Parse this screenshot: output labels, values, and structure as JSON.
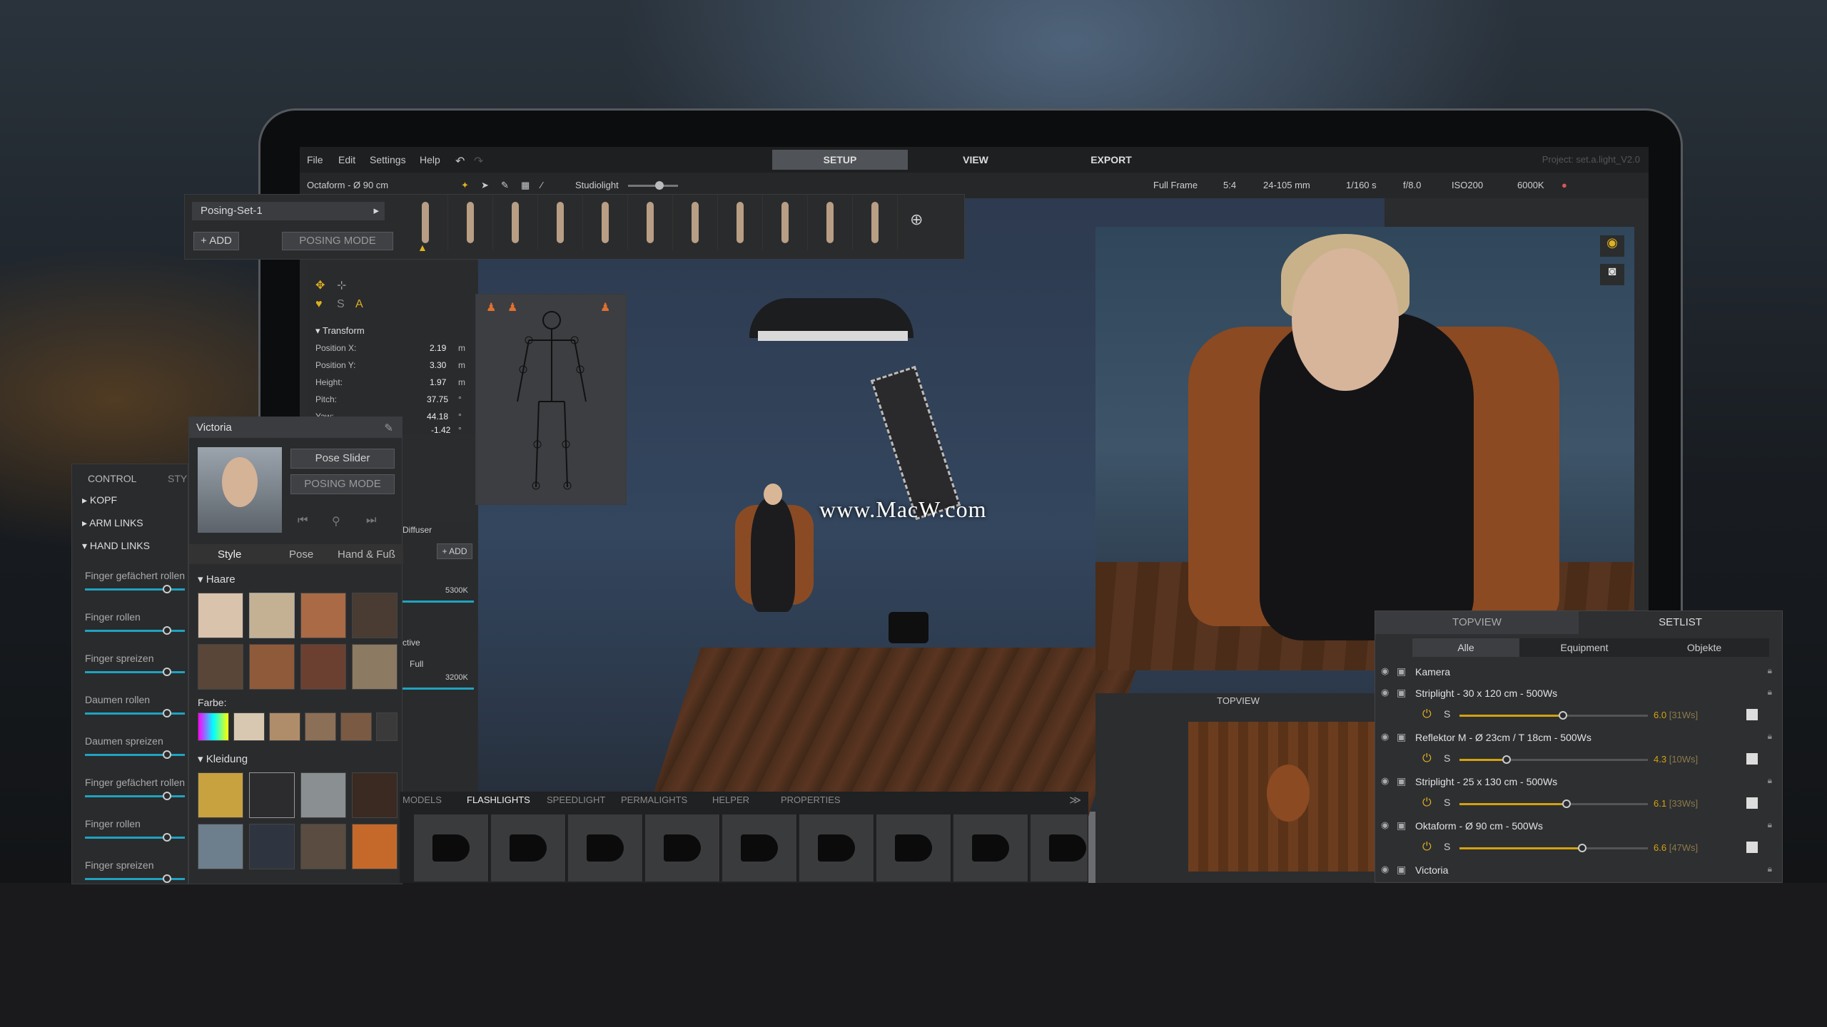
{
  "menu": {
    "file": "File",
    "edit": "Edit",
    "settings": "Settings",
    "help": "Help",
    "tabs": [
      "SETUP",
      "VIEW",
      "EXPORT"
    ],
    "project": "Project: set.a.light_V2.0"
  },
  "toolbar": {
    "object": "Octaform - Ø 90 cm",
    "studiolight": "Studiolight"
  },
  "camera": {
    "frame": "Full Frame",
    "ratio": "5:4",
    "lens": "24-105 mm",
    "shutter": "1/160 s",
    "aperture": "f/8.0",
    "iso": "ISO200",
    "kelvin": "6000K"
  },
  "posing": {
    "set": "Posing-Set-1",
    "add": "+ ADD",
    "mode": "POSING MODE"
  },
  "transform": {
    "title": "Transform",
    "rows": [
      {
        "label": "Position X:",
        "value": "2.19",
        "unit": "m"
      },
      {
        "label": "Position Y:",
        "value": "3.30",
        "unit": "m"
      },
      {
        "label": "Height:",
        "value": "1.97",
        "unit": "m"
      },
      {
        "label": "Pitch:",
        "value": "37.75",
        "unit": "°"
      },
      {
        "label": "Yaw:",
        "value": "44.18",
        "unit": "°"
      },
      {
        "label": "",
        "value": "-1.42",
        "unit": "°"
      }
    ]
  },
  "victoria": {
    "name": "Victoria",
    "pose_slider": "Pose Slider",
    "posing_mode": "POSING MODE",
    "tabs": [
      "Style",
      "Pose",
      "Hand & Fuß"
    ],
    "add": "+ ADD",
    "hair": "Haare",
    "color": "Farbe:",
    "clothing": "Kleidung"
  },
  "side": {
    "diffuser": "Diffuser",
    "k1": "5300K",
    "active": "ctive",
    "full": "Full",
    "k2": "3200K"
  },
  "control": {
    "tabs": [
      "CONTROL",
      "STY"
    ],
    "items": [
      "KOPF",
      "ARM LINKS",
      "HAND LINKS"
    ],
    "sliders": [
      {
        "label": "Finger gefächert rollen",
        "value": 0.82
      },
      {
        "label": "Finger rollen",
        "value": 0.82
      },
      {
        "label": "Finger spreizen",
        "value": 0.82
      },
      {
        "label": "Daumen rollen",
        "value": 0.82
      },
      {
        "label": "Daumen spreizen",
        "value": 0.82
      },
      {
        "label": "Finger gefächert rollen",
        "value": 0.82
      },
      {
        "label": "Finger rollen",
        "value": 0.82
      },
      {
        "label": "Finger spreizen",
        "value": 0.82
      }
    ]
  },
  "bottombar": {
    "tabs": [
      "MODELS",
      "FLASHLIGHTS",
      "SPEEDLIGHT",
      "PERMALIGHTS",
      "HELPER",
      "PROPERTIES"
    ]
  },
  "topview": {
    "label": "TOPVIEW"
  },
  "setlist": {
    "tabs": [
      "TOPVIEW",
      "SETLIST"
    ],
    "filters": [
      "Alle",
      "Equipment",
      "Objekte"
    ],
    "items": [
      {
        "name": "Kamera"
      },
      {
        "name": "Striplight - 30 x 120 cm - 500Ws",
        "power": "6.0",
        "ws": "[31Ws]",
        "level": 0.55
      },
      {
        "name": "Reflektor M - Ø 23cm / T 18cm - 500Ws",
        "power": "4.3",
        "ws": "[10Ws]",
        "level": 0.25
      },
      {
        "name": "Striplight - 25 x 130 cm - 500Ws",
        "power": "6.1",
        "ws": "[33Ws]",
        "level": 0.57
      },
      {
        "name": "Oktaform - Ø 90 cm - 500Ws",
        "power": "6.6",
        "ws": "[47Ws]",
        "level": 0.65
      },
      {
        "name": "Victoria"
      }
    ],
    "s_label": "S"
  },
  "watermark": "www.MacW.com"
}
